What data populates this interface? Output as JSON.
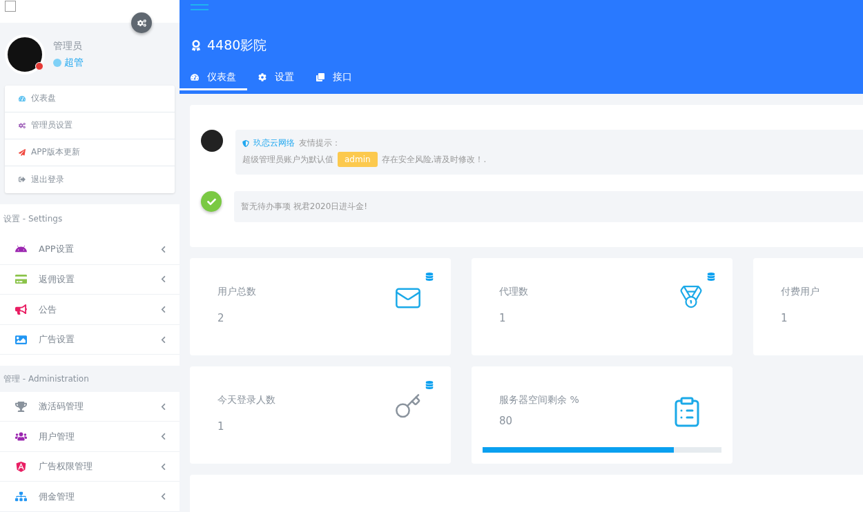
{
  "top_checkbox": {
    "checked": false
  },
  "profile": {
    "name": "管理员",
    "role": "超管"
  },
  "profile_menu": [
    {
      "label": "仪表盘"
    },
    {
      "label": "管理员设置"
    },
    {
      "label": "APP版本更新"
    },
    {
      "label": "退出登录"
    }
  ],
  "sidebar": {
    "sections": [
      {
        "title": "设置 - Settings",
        "items": [
          {
            "label": "APP设置"
          },
          {
            "label": "返佣设置"
          },
          {
            "label": "公告"
          },
          {
            "label": "广告设置"
          }
        ]
      },
      {
        "title": "管理 - Administration",
        "items": [
          {
            "label": "激活码管理"
          },
          {
            "label": "用户管理"
          },
          {
            "label": "广告权限管理"
          },
          {
            "label": "佣金管理"
          }
        ]
      }
    ]
  },
  "header": {
    "title": "4480影院",
    "tabs": [
      {
        "label": "仪表盘",
        "selected": true
      },
      {
        "label": "设置",
        "selected": false
      },
      {
        "label": "接口",
        "selected": false
      }
    ]
  },
  "notices": [
    {
      "kind": "message",
      "source": "玖恋云网络",
      "heading": "友情提示：",
      "text_before": "超级管理员账户为默认值",
      "badge": "admin",
      "text_after": "存在安全风险,请及时修改！."
    },
    {
      "kind": "done",
      "text": "暂无待办事项 祝君2020日进斗金!"
    }
  ],
  "stats": [
    {
      "kind": "count",
      "label": "用户总数",
      "value": "2"
    },
    {
      "kind": "count",
      "label": "代理数",
      "value": "1"
    },
    {
      "kind": "count",
      "label": "付费用户",
      "value": "1"
    },
    {
      "kind": "count",
      "label": "今天登录人数",
      "value": "1"
    },
    {
      "kind": "meter",
      "label": "服务器空间剩余 %",
      "value": "80",
      "level": 0.8
    }
  ]
}
